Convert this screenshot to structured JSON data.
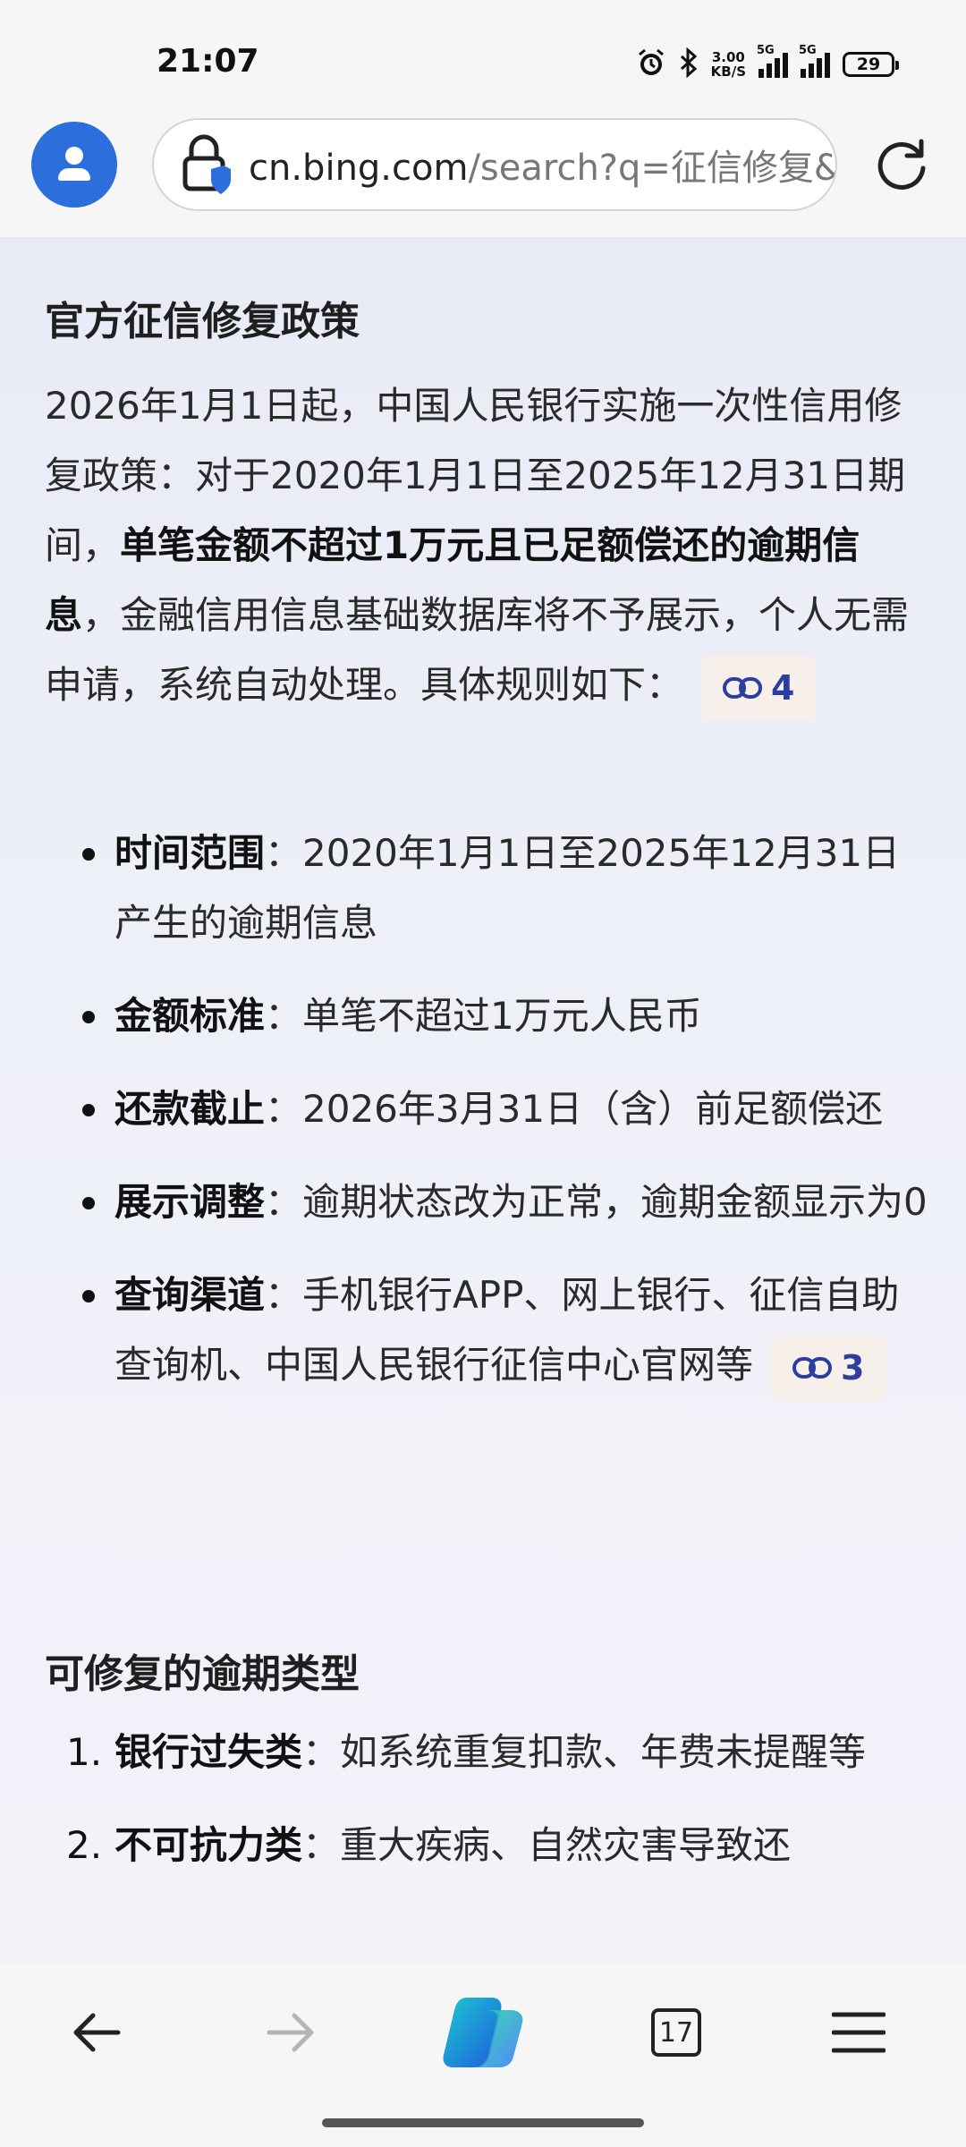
{
  "status_bar": {
    "time": "21:07",
    "alarm_icon": "alarm-icon",
    "bluetooth_icon": "bluetooth-icon",
    "net_speed_value": "3.00",
    "net_speed_unit": "KB/S",
    "signal_tag_1": "5G",
    "signal_tag_2": "5G",
    "battery": "29"
  },
  "browser": {
    "url_host": "cn.bing.com",
    "url_path": "/search?q=征信修复&",
    "avatar_icon": "profile-icon",
    "lock_icon": "lock-shield-icon",
    "reload_icon": "reload-icon"
  },
  "article": {
    "section1_title": "官方征信修复政策",
    "intro_part1": "2026年1月1日起，中国人民银行实施一次性信用修复政策：对于2020年1月1日至2025年12月31日期间，",
    "intro_bold": "单笔金额不超过1万元且已足额偿还的逾期信息",
    "intro_part2": "，金融信用信息基础数据库将不予展示，个人无需申请，系统自动处理。具体规则如下：",
    "intro_citation": "4",
    "rules": [
      {
        "label": "时间范围",
        "text": "：2020年1月1日至2025年12月31日产生的逾期信息"
      },
      {
        "label": "金额标准",
        "text": "：单笔不超过1万元人民币"
      },
      {
        "label": "还款截止",
        "text": "：2026年3月31日（含）前足额偿还"
      },
      {
        "label": "展示调整",
        "text": "：逾期状态改为正常，逾期金额显示为0"
      },
      {
        "label": "查询渠道",
        "text": "：手机银行APP、网上银行、征信自助查询机、中国人民银行征信中心官网等"
      }
    ],
    "rules_citation": "3",
    "section2_title": "可修复的逾期类型",
    "types": [
      {
        "num": "1.",
        "label": "银行过失类",
        "text": "：如系统重复扣款、年费未提醒等"
      },
      {
        "num": "2.",
        "label": "不可抗力类",
        "text": "：重大疾病、自然灾害导致还"
      }
    ]
  },
  "bottom_nav": {
    "back_icon": "back-arrow-icon",
    "forward_icon": "forward-arrow-icon",
    "copilot_icon": "copilot-icon",
    "tab_count": "17",
    "menu_icon": "menu-icon"
  },
  "colors": {
    "accent": "#2c6fdc",
    "citation_text": "#2c3ea0",
    "citation_bg": "#f7efe9",
    "content_bg": "#eef0f8"
  }
}
